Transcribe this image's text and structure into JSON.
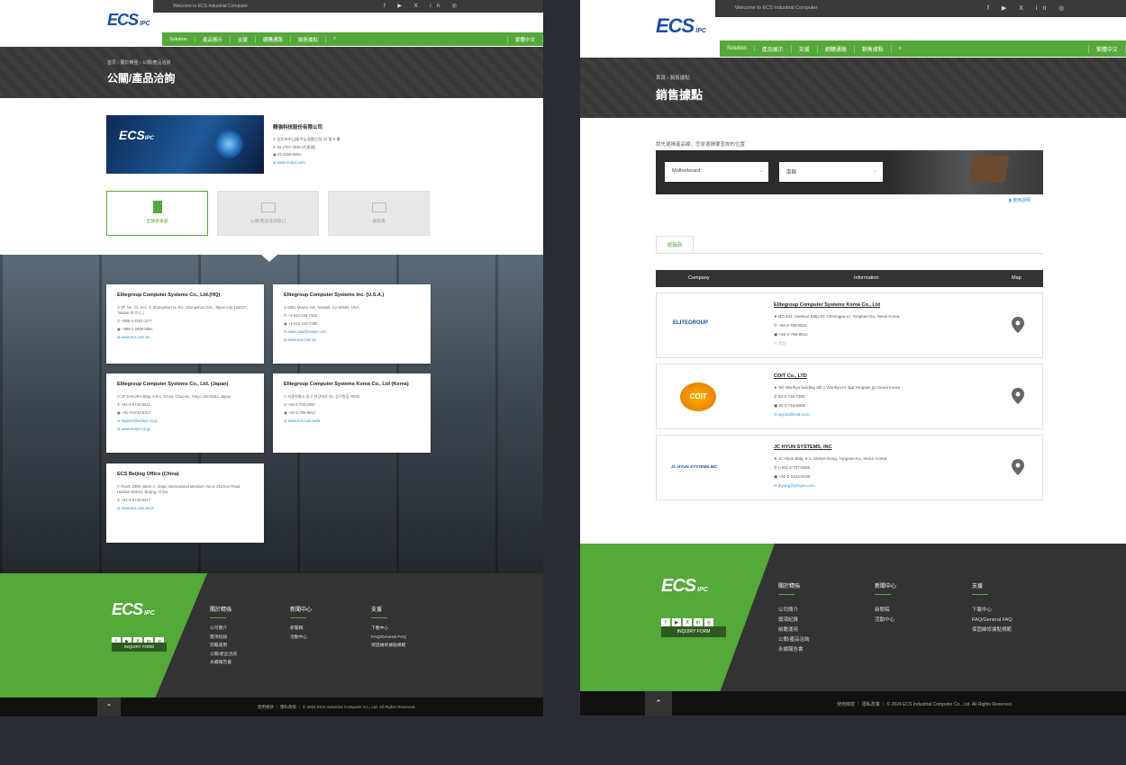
{
  "site": {
    "welcome": "Welcome to ECS Industrial Computer",
    "logo_main": "ECS",
    "logo_sub": "IPC",
    "social_icons": [
      "facebook-icon",
      "youtube-icon",
      "x-icon",
      "linkedin-icon",
      "instagram-icon"
    ],
    "nav": [
      "Solution",
      "產品展示",
      "支援",
      "網購通路",
      "銷售據點"
    ],
    "lang": "繁體中文",
    "accent": "#55a83a",
    "dark": "#333333"
  },
  "left": {
    "breadcrumb": [
      "首頁",
      "關於精強",
      "公關/產品洽詢"
    ],
    "title": "公關/產品洽詢",
    "company": {
      "name": "精強科技股份有限公司",
      "address": "台北市中山區中山北路三段 22 號 8 樓",
      "phone": "02-2767-2828 (代表號)",
      "fax": "02-2658-8891",
      "web": "www.ecsipc.com"
    },
    "tabs": [
      "全球辦事處",
      "公關/產品洽詢窗口",
      "填寫表"
    ],
    "offices": [
      {
        "title": "Elitegroup Computer Systems Co., Ltd.(HQ)",
        "addr": "8F, No. 22, Sec. 3, Zhongshan N. Rd., Zhongshan Dist., Taipei City 104027, Taiwan (R.O.C.)",
        "tel": "+886-2-2162-1177",
        "fax": "+886-2-2658-8891",
        "web": "www.ecs.com.tw"
      },
      {
        "title": "Elitegroup Computer Systems Inc. (U.S.A.)",
        "addr": "6851 Mowry Ave, Newark, CA 94560, USA",
        "tel": "+1-510-226-7333",
        "fax": "+1-510-226-7350",
        "mail": "sales.usa@ecsipc.com",
        "web": "www.ecs.com.tw"
      },
      {
        "title": "Elitegroup Computer Systems Co., Ltd. (Japan)",
        "addr": "2F SAKURA Bldg, 4-6-1, Ginza, Chuo-ku, Tokyo 104-0061, Japan",
        "tel": "+81-3-5743-6421",
        "fax": "+81-3-5743-6417",
        "mail": "support@ecsipc.co.jp",
        "web": "www.ecsipc.co.jp"
      },
      {
        "title": "Elitegroup Computer Systems Korea Co., Ltd (Korea)",
        "addr": "서울특별시 중구 한강대로 40, 삼구빌딩 405호",
        "tel": "+82-2-706-2600",
        "fax": "+82-2-785-8612",
        "web": "www.ecs.com.tw/kr"
      },
      {
        "title": "ECS Beijing Office (China)",
        "addr": "Room 2306, Block A, Jinqiu International Mansion, No.6, Zhichun Road, Haidian District, Beijing, China",
        "tel": "+81-3-5743-6417",
        "web": "www.ecs.com.tw/cn"
      }
    ]
  },
  "right": {
    "breadcrumb": [
      "首頁",
      "銷售據點"
    ],
    "title": "銷售據點",
    "hint": "請先選擇產品線，您會選擇要查詢的位置",
    "select_product": "Motherboard",
    "select_region": "南韓",
    "map_help": "使用說明",
    "tab": "經銷商",
    "table_headers": [
      "Company",
      "Information",
      "Map"
    ],
    "dealers": [
      {
        "logo": "ELITEGROUP",
        "name": "Elitegroup Computer Systems Korea Co., Ltd",
        "addr": "NO.403, Samkoo Bldg 40, Cheongpa-ro, Yongsan-Gu, Seoul Korea",
        "tel": "+82-2-785-8611",
        "fax": "+82-2-785-8612",
        "extra": "地址"
      },
      {
        "logo": "COIT",
        "name": "COIT Co., LTD",
        "addr": "'Mi' Wonhyo building 4th 1 Wonhyo-ro 3ga Yongsan gu Seoul Korea",
        "tel": "82-2-716-7303",
        "fax": "82-2-716-8808",
        "mail": "wychs@coit.co.kr"
      },
      {
        "logo": "JC HYUN SYSTEMS,INC",
        "name": "JC HYUN SYSTEMS, INC",
        "addr": "JC Hyun Bldg, 6-1, Sinkye-Dong, Yongsan-Ku, Seoul, Korea",
        "tel": "(+82)-2-707-5055",
        "fax": "+82-2-2103-9199",
        "mail": "jhyung@jchyun.com"
      }
    ]
  },
  "footer": {
    "inquiry": "INQUIRY FORM",
    "cols": [
      {
        "head": "關於精強",
        "items": [
          "公司簡介",
          "獎項紀錄",
          "前瞻運用",
          "公關/產品洽詢",
          "永續報告書"
        ]
      },
      {
        "head": "新聞中心",
        "items": [
          "新聞稿",
          "活動中心"
        ]
      },
      {
        "head": "支援",
        "items": [
          "下載中心",
          "FAQ/General FAQ",
          "保固維修據點規範"
        ]
      }
    ],
    "terms": "使用條款",
    "privacy": "隱私政策",
    "copyright": "© 2024 ECS Industrial Computer Co., Ltd. All Rights Reserved."
  }
}
